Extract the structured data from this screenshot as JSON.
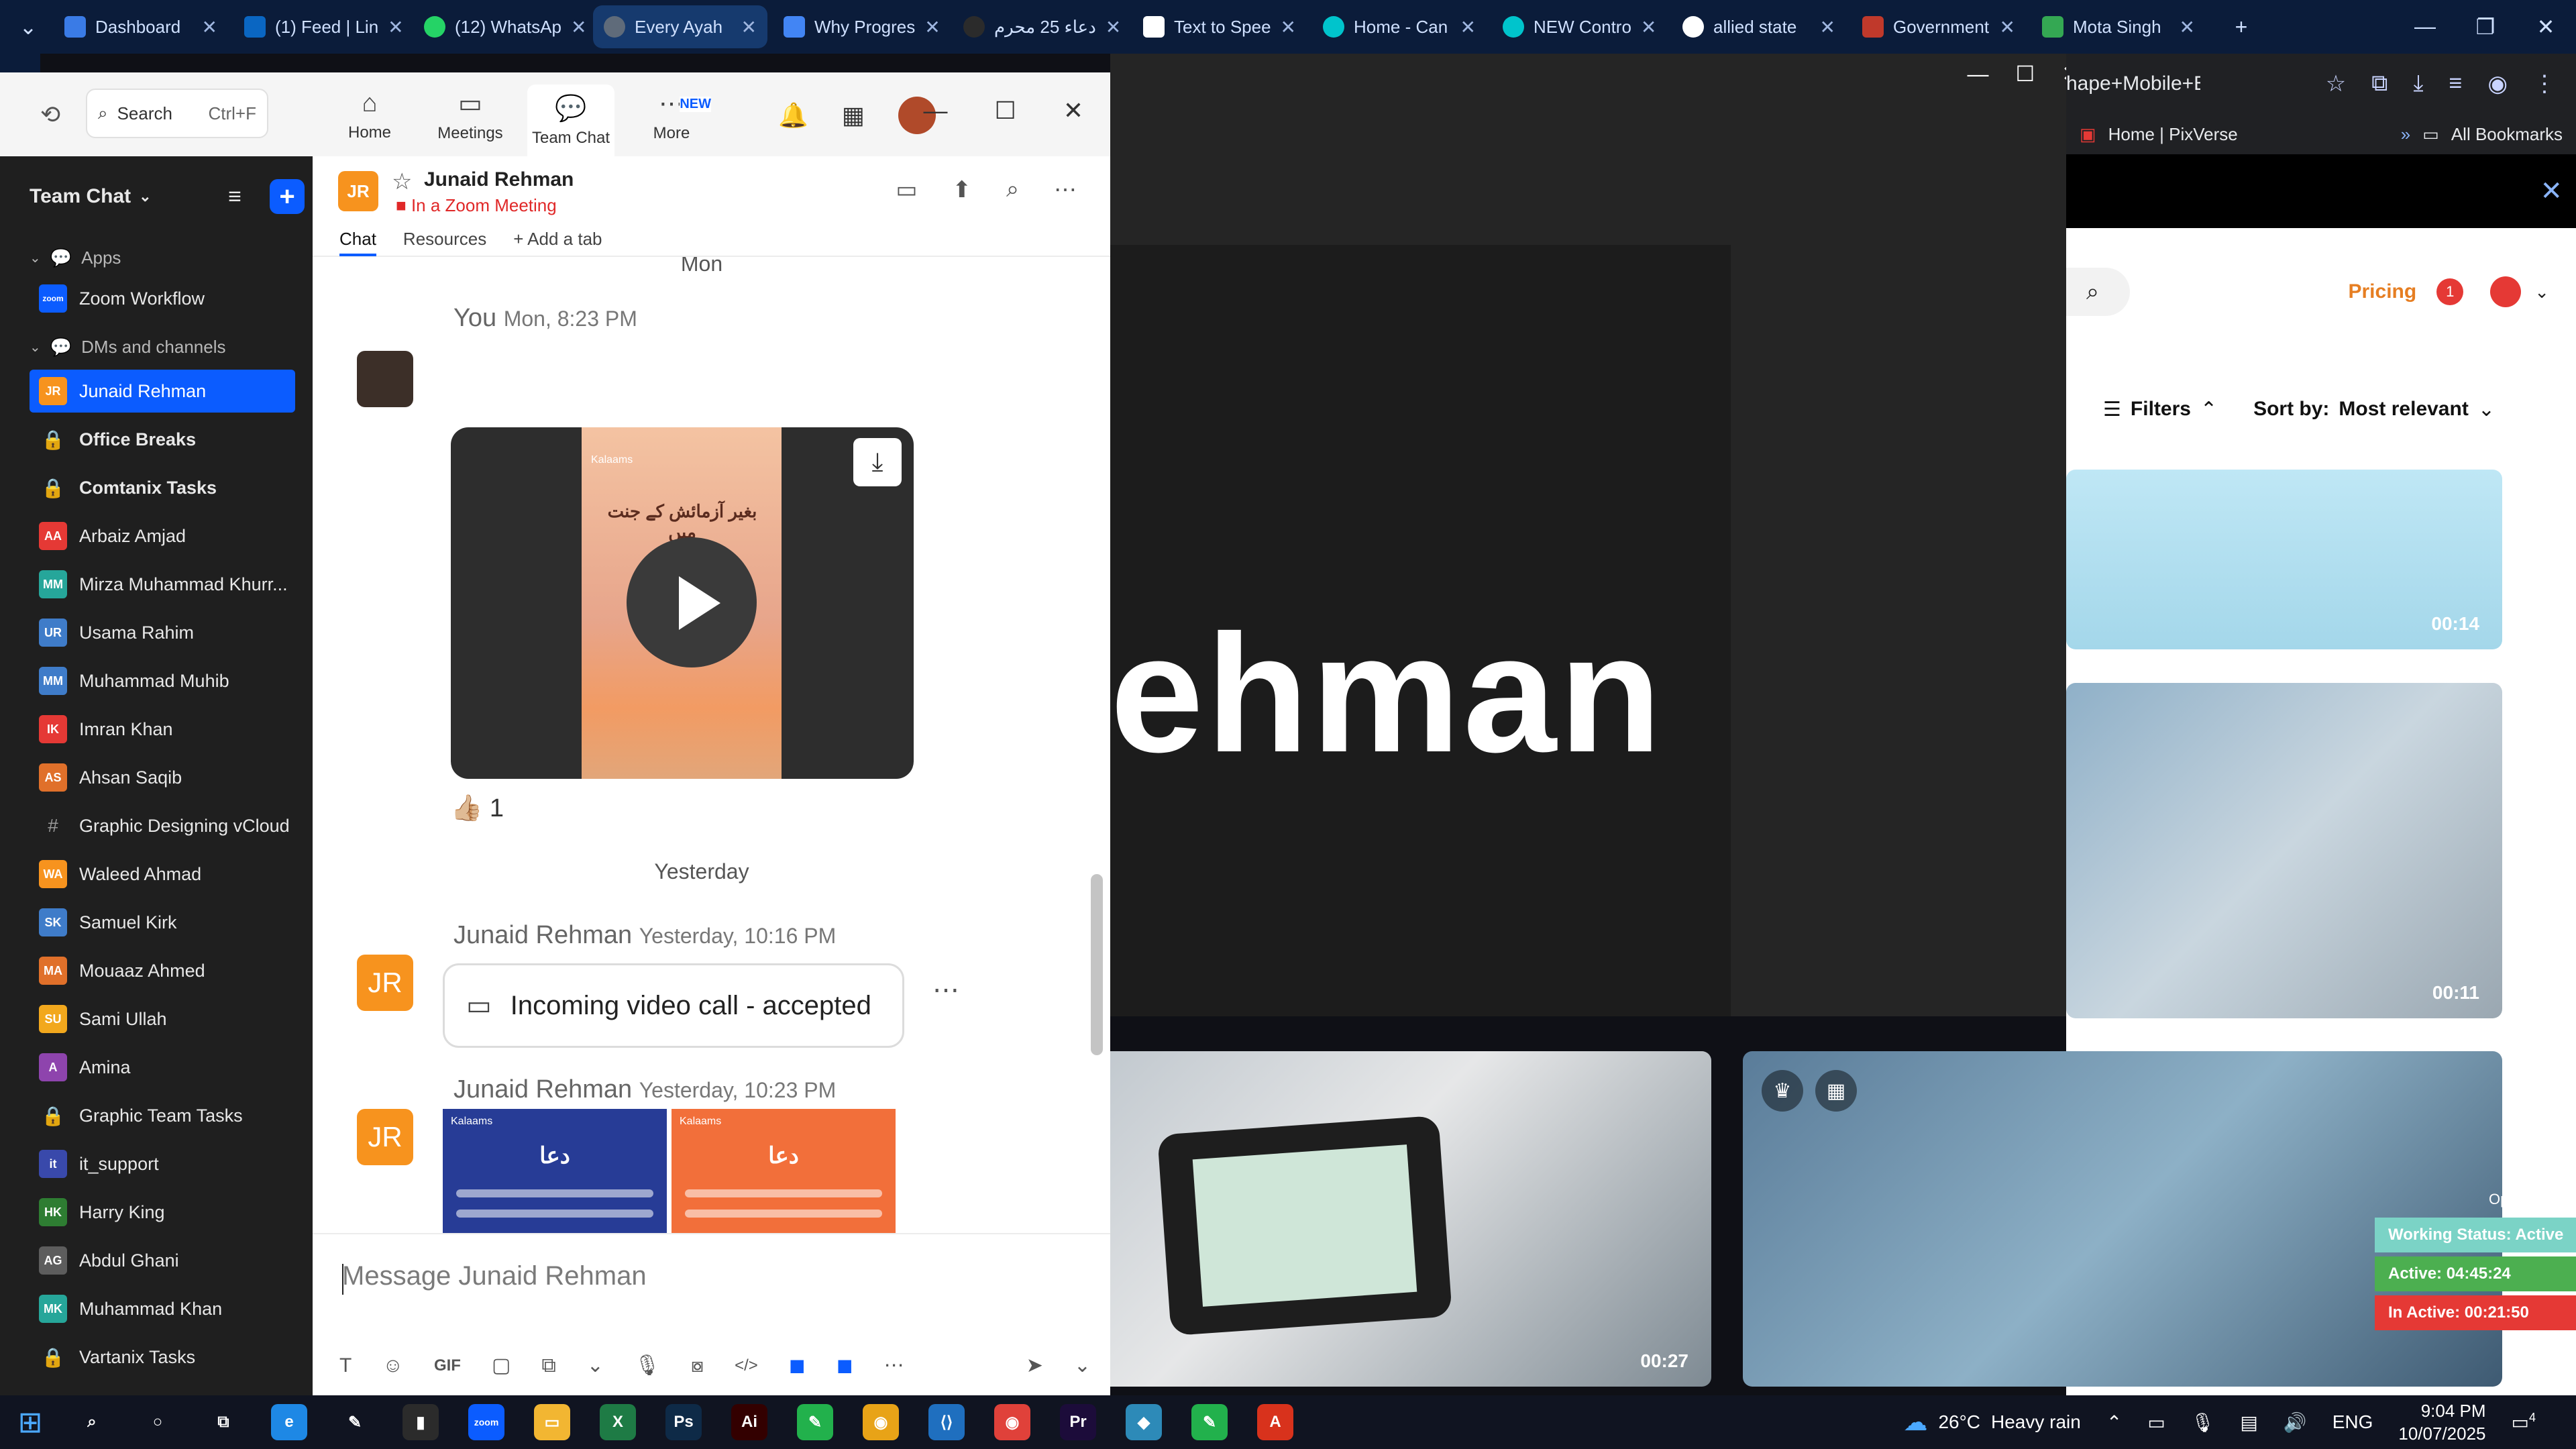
{
  "chrome": {
    "tabs": [
      {
        "label": "Dashboard",
        "icon": "dashboard-tab-icon"
      },
      {
        "label": "(1) Feed | Lin",
        "icon": "linkedin-icon"
      },
      {
        "label": "(12) WhatsAp",
        "icon": "whatsapp-icon"
      },
      {
        "label": "Every Ayah",
        "icon": "globe-icon"
      },
      {
        "label": "Why Progres",
        "icon": "doc-icon"
      },
      {
        "label": "دعاء 25 محرم",
        "icon": "chatgpt-icon"
      },
      {
        "label": "Text to Spee",
        "icon": "tts-icon"
      },
      {
        "label": "Home - Can",
        "icon": "canva-icon"
      },
      {
        "label": "NEW Contro",
        "icon": "canva-icon"
      },
      {
        "label": "allied state",
        "icon": "google-icon"
      },
      {
        "label": "Government",
        "icon": "gov-icon"
      },
      {
        "label": "Mota Singh",
        "icon": "map-icon"
      }
    ],
    "new_tab": "+",
    "window_controls": [
      "—",
      "❐",
      "✕"
    ]
  },
  "pixverse": {
    "url_fragment": "hape+Mobile+Ex...",
    "bookmark": "Home | PixVerse",
    "all_bookmarks": "All Bookmarks",
    "pricing": "Pricing",
    "badge_count": "1",
    "filters_label": "Filters",
    "sort_label": "Sort by:",
    "sort_value": "Most relevant",
    "durations": [
      "00:14",
      "00:11",
      "00:27"
    ],
    "open_app": "Open App ↗",
    "working_status": "Working Status: Active",
    "active_time": "Active: 04:45:24",
    "inactive_time": "In Active: 00:21:50"
  },
  "bg_window": {
    "big_text": "ehman"
  },
  "zoom": {
    "search_label": "Search",
    "search_shortcut": "Ctrl+F",
    "nav_tabs": [
      {
        "label": "Home",
        "icon": "⌂"
      },
      {
        "label": "Meetings",
        "icon": "▭"
      },
      {
        "label": "Team Chat",
        "icon": "💬"
      },
      {
        "label": "More",
        "icon": "⋯"
      }
    ],
    "new_badge": "NEW",
    "sidebar": {
      "title": "Team Chat",
      "sec_apps": "Apps",
      "sec_dms": "DMs and channels",
      "app_items": [
        {
          "label": "Zoom Workflow",
          "initials": "zoom",
          "color": "#0b5cff"
        }
      ],
      "items": [
        {
          "label": "Junaid Rehman",
          "initials": "JR",
          "color": "#f7931e",
          "selected": true
        },
        {
          "label": "Office Breaks",
          "lock": true,
          "bold": true
        },
        {
          "label": "Comtanix Tasks",
          "lock": true,
          "bold": true
        },
        {
          "label": "Arbaiz Amjad",
          "initials": "AA",
          "color": "#e53935"
        },
        {
          "label": "Mirza Muhammad Khurr...",
          "initials": "MM",
          "color": "#26a69a"
        },
        {
          "label": "Usama Rahim",
          "initials": "UR",
          "color": "#3f7cc9"
        },
        {
          "label": "Muhammad Muhib",
          "initials": "MM",
          "color": "#3f7cc9"
        },
        {
          "label": "Imran Khan",
          "initials": "IK",
          "color": "#e53935"
        },
        {
          "label": "Ahsan Saqib",
          "initials": "AS",
          "color": "#e0702a"
        },
        {
          "label": "Graphic Designing vCloud",
          "hash": true
        },
        {
          "label": "Waleed Ahmad",
          "initials": "WA",
          "color": "#f7931e"
        },
        {
          "label": "Samuel Kirk",
          "initials": "SK",
          "color": "#3f7cc9"
        },
        {
          "label": "Mouaaz Ahmed",
          "initials": "MA",
          "color": "#e0702a"
        },
        {
          "label": "Sami Ullah",
          "initials": "SU",
          "color": "#f2a81d"
        },
        {
          "label": "Amina",
          "initials": "A",
          "color": "#8e44ad"
        },
        {
          "label": "Graphic Team Tasks",
          "lock": true
        },
        {
          "label": "it_support",
          "initials": "it",
          "color": "#3949ab"
        },
        {
          "label": "Harry King",
          "initials": "HK",
          "color": "#2e7d32"
        },
        {
          "label": "Abdul Ghani",
          "initials": "AG",
          "color": "#5d5d5d"
        },
        {
          "label": "Muhammad Khan",
          "initials": "MK",
          "color": "#26a69a"
        },
        {
          "label": "Vartanix Tasks",
          "lock": true
        }
      ]
    },
    "chat": {
      "name": "Junaid Rehman",
      "initials": "JR",
      "status": "In a Zoom Meeting",
      "tabs": [
        "Chat",
        "Resources",
        "+ Add a tab"
      ],
      "day_mon": "Mon",
      "you": "You",
      "you_time": "Mon, 8:23 PM",
      "video_poster_title": "بغیر آزمائش کے جنت میں",
      "kalaams": "Kalaams",
      "reaction": "👍🏼 1",
      "day_yesterday": "Yesterday",
      "msg1_name": "Junaid Rehman",
      "msg1_time": "Yesterday, 10:16 PM",
      "call_text": "Incoming video call - accepted",
      "msg2_name": "Junaid Rehman",
      "msg2_time": "Yesterday, 10:23 PM",
      "dua_title": "دعا",
      "input_placeholder": "Message Junaid Rehman",
      "tools": [
        "T",
        "☺",
        "GIF",
        "▢",
        "⧉",
        "⌄",
        "🎙",
        "⧇",
        "</>",
        "◼",
        "◼",
        "⋯"
      ]
    }
  },
  "taskbar": {
    "weather_temp": "26°C",
    "weather_desc": "Heavy rain",
    "lang": "ENG",
    "time": "9:04 PM",
    "date": "10/07/2025",
    "notif_count": "4",
    "apps": [
      {
        "name": "search",
        "glyph": "⌕",
        "color": "transparent"
      },
      {
        "name": "cortana",
        "glyph": "○",
        "color": "transparent"
      },
      {
        "name": "taskview",
        "glyph": "⧉",
        "color": "transparent"
      },
      {
        "name": "edge",
        "glyph": "e",
        "color": "#1e88e5"
      },
      {
        "name": "pen",
        "glyph": "✎",
        "color": "transparent"
      },
      {
        "name": "terminal",
        "glyph": "▮",
        "color": "#2b2b2b"
      },
      {
        "name": "zoom",
        "glyph": "zoom",
        "color": "#0b5cff"
      },
      {
        "name": "explorer",
        "glyph": "▭",
        "color": "#f2b632"
      },
      {
        "name": "excel",
        "glyph": "X",
        "color": "#1e7b45"
      },
      {
        "name": "photoshop",
        "glyph": "Ps",
        "color": "#0e2a47"
      },
      {
        "name": "illustrator",
        "glyph": "Ai",
        "color": "#330000"
      },
      {
        "name": "app-green",
        "glyph": "✎",
        "color": "#22b14c"
      },
      {
        "name": "chrome",
        "glyph": "◉",
        "color": "#e8a317"
      },
      {
        "name": "vscode",
        "glyph": "⟨⟩",
        "color": "#1f6fbf"
      },
      {
        "name": "chrome-2",
        "glyph": "◉",
        "color": "#e0413a"
      },
      {
        "name": "premiere",
        "glyph": "Pr",
        "color": "#1c0c3a"
      },
      {
        "name": "app-cube",
        "glyph": "◆",
        "color": "#2d8ab8"
      },
      {
        "name": "app-green-2",
        "glyph": "✎",
        "color": "#22b14c"
      },
      {
        "name": "acrobat",
        "glyph": "A",
        "color": "#d8321c"
      }
    ]
  }
}
